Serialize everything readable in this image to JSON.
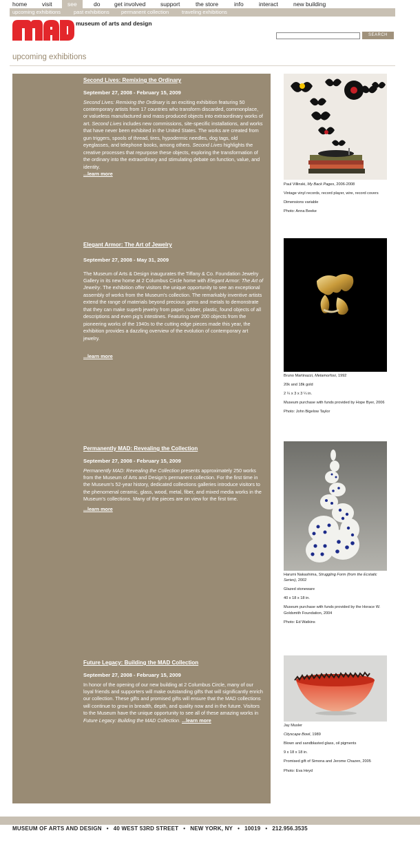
{
  "nav": {
    "items": [
      "home",
      "visit",
      "see",
      "do",
      "get involved",
      "support",
      "the store",
      "info",
      "interact",
      "new building"
    ],
    "active": "see"
  },
  "subnav": {
    "items": [
      "upcoming exhibitions",
      "past exhibitions",
      "permanent collection",
      "traveling exhibitions"
    ]
  },
  "brand": {
    "logo": "MAD",
    "name": "museum of arts and design",
    "accent": "#e3272b"
  },
  "search": {
    "value": "",
    "button": "SEARCH"
  },
  "page": {
    "title": "upcoming exhibitions"
  },
  "exhibitions": [
    {
      "title": "Second Lives: Remixing the Ordinary",
      "dates": "September 27, 2008 - February 15, 2009",
      "lead_italic": "Second Lives: Remixing the Ordinary",
      "body1": " is an exciting exhibition featuring 50 contemporary artists from 17 countries who transform discarded, commonplace, or valueless manufactured and mass-produced objects into extraordinary works of art. ",
      "italic2": "Second Lives",
      "body2": " includes new commissions, site-specific installations, and works that have never been exhibited in the United States. The works are created from gun triggers, spools of thread, tires, hypodermic needles, dog tags, old eyeglasses, and telephone books, among others. ",
      "italic3": "Second Lives",
      "body3": " highlights the creative processes that repurpose these objects, exploring the transformation of the ordinary into the extraordinary and stimulating debate on function, value, and identity.",
      "more": "...learn more",
      "caption": {
        "line1_pre": "Paul Villinski, ",
        "line1_italic": "My Back Pages",
        "line1_post": ", 2006-2008",
        "lines": [
          "Vintage vinyl records, record player, wire, record covers",
          "Dimensions variable",
          "Photo: Anna Beeke"
        ]
      }
    },
    {
      "title": "Elegant Armor: The Art of Jewelry",
      "dates": "September 27, 2008 - May 31, 2009",
      "body1": "The Museum of Arts & Design  inaugurates the Tiffany & Co. Foundation Jewelry Gallery in its new home at 2 Columbus Circle home with ",
      "italic1": "Elegant Armor: The Art of Jewelry",
      "body2": ". The exhibition offer visitors the unique opportunity to see an exceptional assembly of works from the Museum's collection. The remarkably inventive artists extend the range of materials beyond precious gems and metals to demonstrate that they can make superb jewelry from paper, rubber, plastic, found objects of all descriptions and even pig's intestines. Featuring over 200 objects from the pioneering works of the 1940s to the cutting edge pieces made this year, the exhibition provides a dazzling overview of the evolution of contemporary art jewelry.",
      "more": "...learn more",
      "caption": {
        "line1_pre": "Bruno Martinazzi, ",
        "line1_italic": "Metamorfosi",
        "line1_post": ", 1992",
        "lines": [
          "20k and 18k gold",
          "2 ¼ x 3 x 3 ¼ in.",
          "Museum purchase with funds provided by Hope Byer, 2006",
          "Photo: John Bigelow Taylor"
        ]
      }
    },
    {
      "title": "Permanently MAD: Revealing the Collection",
      "dates": "September 27, 2008 - February 15, 2009",
      "lead_italic": "Permanently MAD: Revealing the Collection",
      "body1": " presents approximately 250 works from the Museum of Arts and Design's permanent collection. For the first time in the Museum's 52-year history, dedicated collections galleries introduce visitors to the phenomenal ceramic, glass, wood, metal, fiber, and mixed media works in the Museum's collections. Many of the pieces are on view for the first time.",
      "more": "...learn more",
      "caption": {
        "line1_pre": "Harumi Nakashima, ",
        "line1_italic": "Struggling Form (from the Ecstatic Series)",
        "line1_post": ", 2002",
        "lines": [
          "Glazed stoneware",
          "40 x 18 x 18 in.",
          "Museum purchase with funds provided by the Horace W. Goldsmith Foundation, 2004",
          "Photo: Ed Watkins"
        ]
      }
    },
    {
      "title": "Future Legacy: Building the MAD Collection",
      "dates": "September 27, 2008 - February 15, 2009",
      "body1": "In honor of the opening of our new building at 2 Columbus Circle, many of our loyal friends and supporters will make outstanding gifts that will significantly enrich our collection. These gifts and promised gifts will ensure that the MAD collections will continue to grow in breadth, depth, and quality now and in the future. Visitors to the Museum have the unique opportunity to see all of these amazing works in ",
      "italic1": "Future Legacy: Building the MAD Collection",
      "body2": ". ",
      "more": "...learn more",
      "caption": {
        "line0": "Jay Musler",
        "line1_italic": "Cityscape Bowl",
        "line1_post": ", 1989",
        "lines": [
          "Blown and sandblasted glass, oil pigments",
          "9 x 18 x 18 in.",
          "Promised gift of Simona and Jerome Chazen, 2005",
          "Photo: Eva Heyd"
        ]
      }
    }
  ],
  "footer": {
    "parts": [
      "MUSEUM OF ARTS AND DESIGN",
      "40 WEST 53RD STREET",
      "NEW YORK, NY",
      "10019",
      "212.956.3535"
    ],
    "sep": "•"
  }
}
